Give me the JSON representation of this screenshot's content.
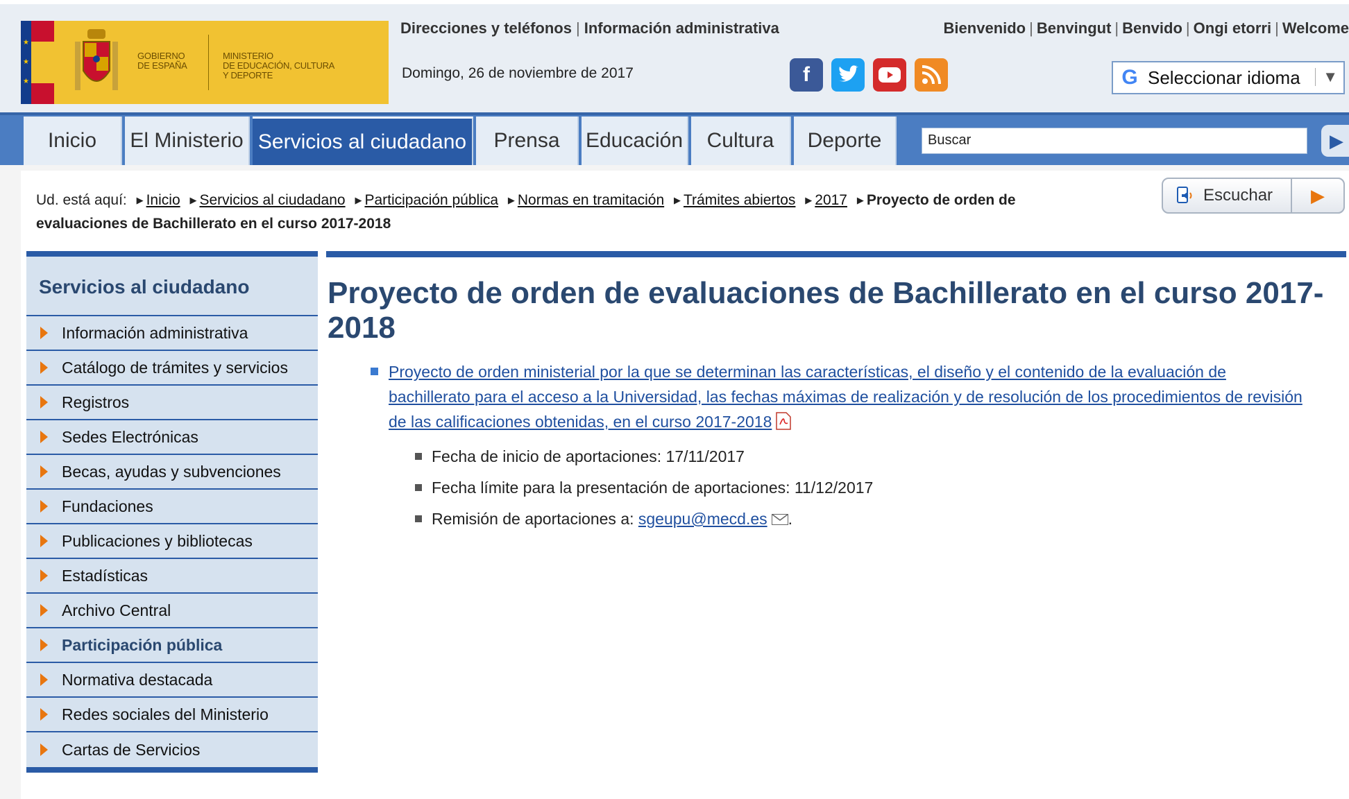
{
  "header": {
    "logo": {
      "government_line1": "GOBIERNO",
      "government_line2": "DE ESPAÑA",
      "ministry_line1": "MINISTERIO",
      "ministry_line2": "DE EDUCACIÓN, CULTURA",
      "ministry_line3": "Y DEPORTE"
    },
    "top_links": [
      "Direcciones y teléfonos",
      "Información administrativa"
    ],
    "date": "Domingo, 26 de noviembre de 2017",
    "social": [
      "facebook-icon",
      "twitter-icon",
      "youtube-icon",
      "rss-icon"
    ],
    "welcome": [
      "Bienvenido",
      "Benvingut",
      "Benvido",
      "Ongi etorri",
      "Welcome"
    ],
    "language_selector": "Seleccionar idioma"
  },
  "nav": {
    "tabs": [
      {
        "label": "Inicio"
      },
      {
        "label": "El Ministerio"
      },
      {
        "label": "Servicios al ciudadano"
      },
      {
        "label": "Prensa"
      },
      {
        "label": "Educación"
      },
      {
        "label": "Cultura"
      },
      {
        "label": "Deporte"
      }
    ],
    "search_value": "Buscar"
  },
  "breadcrumb": {
    "prefix": "Ud. está aquí:",
    "links": [
      "Inicio",
      "Servicios al ciudadano",
      "Participación pública",
      "Normas en tramitación",
      "Trámites abiertos",
      "2017"
    ],
    "current": "Proyecto de orden de evaluaciones de Bachillerato en el curso 2017-2018"
  },
  "listen_button": "Escuchar",
  "sidebar": {
    "title": "Servicios al ciudadano",
    "items": [
      {
        "label": "Información administrativa"
      },
      {
        "label": "Catálogo de trámites y servicios"
      },
      {
        "label": "Registros"
      },
      {
        "label": "Sedes Electrónicas"
      },
      {
        "label": "Becas, ayudas y subvenciones"
      },
      {
        "label": "Fundaciones"
      },
      {
        "label": "Publicaciones y bibliotecas"
      },
      {
        "label": "Estadísticas"
      },
      {
        "label": "Archivo Central"
      },
      {
        "label": "Participación pública"
      },
      {
        "label": "Normativa destacada"
      },
      {
        "label": "Redes sociales del Ministerio"
      },
      {
        "label": "Cartas de Servicios"
      }
    ],
    "current_item": "Participación pública"
  },
  "main": {
    "title": "Proyecto de orden de evaluaciones de Bachillerato en el curso 2017-2018",
    "document_link": "Proyecto de orden ministerial por la que se determinan las características, el diseño y el contenido de la evaluación de bachillerato para el acceso a la Universidad, las fechas máximas de realización y de resolución de los procedimientos de revisión de las calificaciones obtenidas, en el curso 2017-2018",
    "details": {
      "start_label": "Fecha de inicio de aportaciones: 17/11/2017",
      "deadline_label": "Fecha límite para la presentación de aportaciones: 11/12/2017",
      "remit_label": "Remisión de aportaciones a:",
      "email": "sgeupu@mecd.es",
      "end_punct": "."
    }
  },
  "colors": {
    "nav_blue": "#4b7dc2",
    "active_tab": "#2a5ba6",
    "logo_yellow": "#f1c232",
    "accent_orange": "#e8760f",
    "sidebar_bg": "#d6e2ef",
    "title_color": "#2a4870"
  }
}
